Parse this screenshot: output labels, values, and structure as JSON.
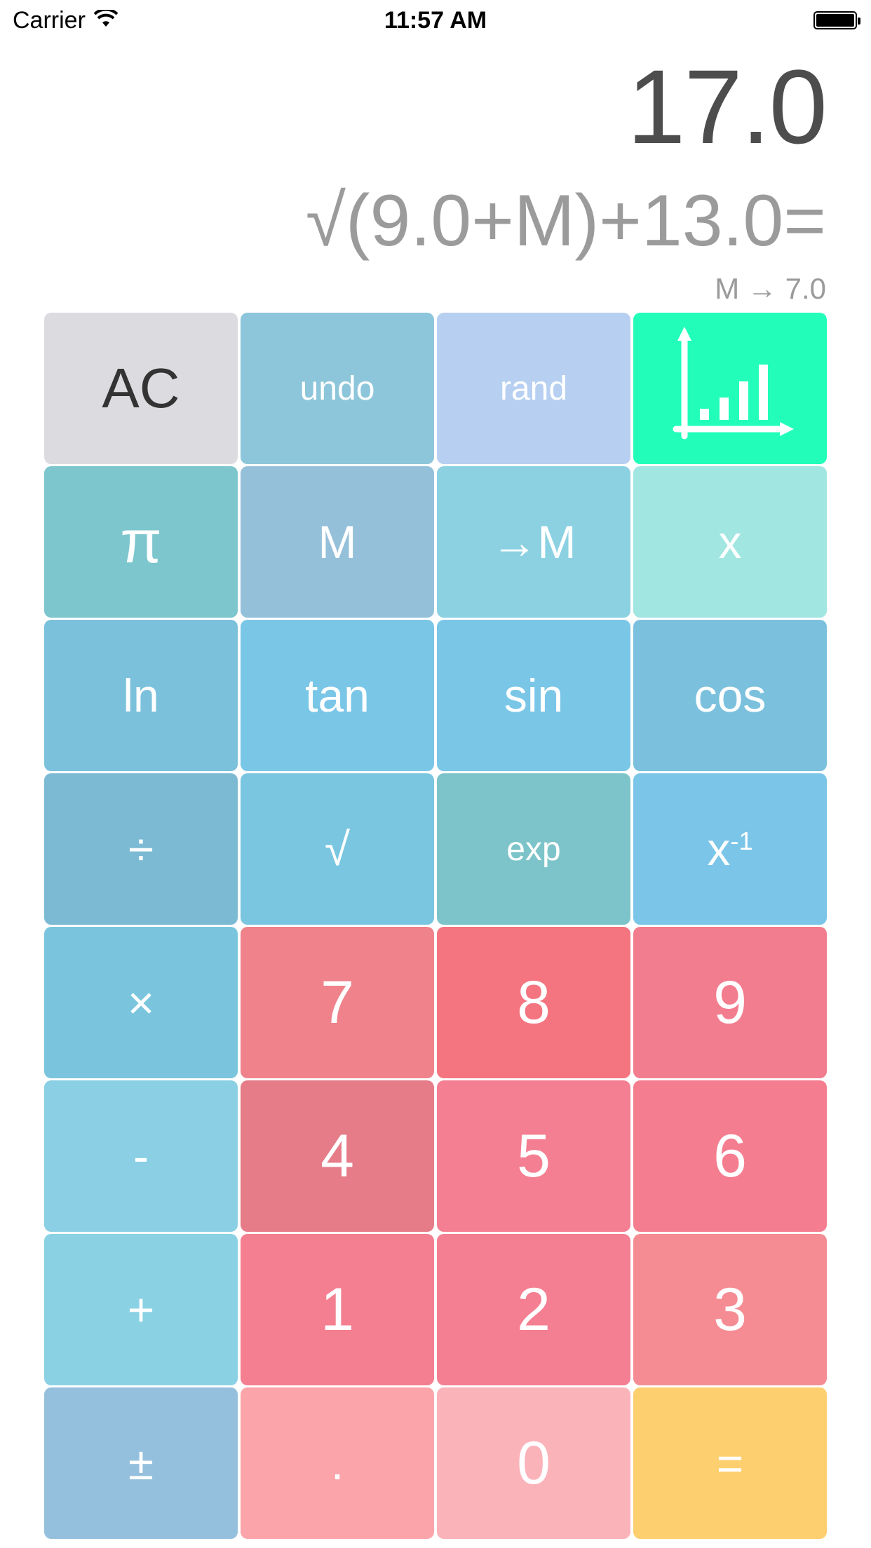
{
  "status_bar": {
    "carrier": "Carrier",
    "time": "11:57 AM",
    "wifi_icon": "wifi-icon",
    "battery_icon": "battery-icon"
  },
  "display": {
    "result": "17.0",
    "expression": "√(9.0+M)+13.0=",
    "memory": "M → 7.0"
  },
  "keys": [
    {
      "id": "ac",
      "label": "AC",
      "color": "#DCDCE0"
    },
    {
      "id": "undo",
      "label": "undo",
      "color": "#8DC6DA"
    },
    {
      "id": "rand",
      "label": "rand",
      "color": "#B7D0F1"
    },
    {
      "id": "graph",
      "icon": "bar-chart-icon",
      "color": "#22FEBA"
    },
    {
      "id": "pi",
      "label": "π",
      "color": "#7DC6CD"
    },
    {
      "id": "m",
      "label": "M",
      "color": "#95C0DA"
    },
    {
      "id": "store-m",
      "label": "→M",
      "color": "#8BD1E2"
    },
    {
      "id": "x",
      "label": "x",
      "color": "#A2E6E1"
    },
    {
      "id": "ln",
      "label": "ln",
      "color": "#7CC1DC"
    },
    {
      "id": "tan",
      "label": "tan",
      "color": "#7AC6E7"
    },
    {
      "id": "sin",
      "label": "sin",
      "color": "#7AC6E7"
    },
    {
      "id": "cos",
      "label": "cos",
      "color": "#7BC1DD"
    },
    {
      "id": "divide",
      "label": "÷",
      "color": "#7CBAD4"
    },
    {
      "id": "sqrt",
      "label": "√",
      "color": "#7AC6E1"
    },
    {
      "id": "exp",
      "label": "exp",
      "color": "#7CC4C9"
    },
    {
      "id": "reciprocal",
      "label": "x",
      "sup": "-1",
      "color": "#7AC5E8"
    },
    {
      "id": "multiply",
      "label": "×",
      "color": "#7AC5DD"
    },
    {
      "id": "seven",
      "label": "7",
      "color": "#EF828B"
    },
    {
      "id": "eight",
      "label": "8",
      "color": "#F47480"
    },
    {
      "id": "nine",
      "label": "9",
      "color": "#F27D8E"
    },
    {
      "id": "minus",
      "label": "-",
      "color": "#8BCFE4"
    },
    {
      "id": "four",
      "label": "4",
      "color": "#E57C88"
    },
    {
      "id": "five",
      "label": "5",
      "color": "#F47F92"
    },
    {
      "id": "six",
      "label": "6",
      "color": "#F47E8F"
    },
    {
      "id": "plus",
      "label": "+",
      "color": "#8BD1E4"
    },
    {
      "id": "one",
      "label": "1",
      "color": "#F47F90"
    },
    {
      "id": "two",
      "label": "2",
      "color": "#F47F92"
    },
    {
      "id": "three",
      "label": "3",
      "color": "#F58C93"
    },
    {
      "id": "plus-minus",
      "label": "±",
      "color": "#95C0DD"
    },
    {
      "id": "decimal",
      "label": ".",
      "color": "#FBA5AA"
    },
    {
      "id": "zero",
      "label": "0",
      "color": "#FBB3BA"
    },
    {
      "id": "equals",
      "label": "=",
      "color": "#FDCF6F"
    }
  ]
}
